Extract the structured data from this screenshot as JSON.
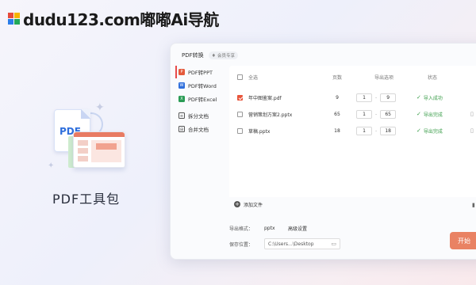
{
  "brand": {
    "text": "dudu123.com嘟嘟Ai导航"
  },
  "left": {
    "pdf_label": "PDF",
    "tool_title": "PDF工具包"
  },
  "window": {
    "title": "PDF转换",
    "vip_label": "会员专享"
  },
  "sidebar": {
    "items": [
      {
        "label": "PDF转PPT",
        "icon": "ppt-icon",
        "active": true
      },
      {
        "label": "PDF转Word",
        "icon": "word-icon"
      },
      {
        "label": "PDF转Excel",
        "icon": "excel-icon"
      },
      {
        "label": "拆分文档",
        "icon": "split-icon"
      },
      {
        "label": "合并文档",
        "icon": "merge-icon"
      }
    ]
  },
  "table": {
    "headers": {
      "select_all": "全选",
      "pages": "页数",
      "range": "导出选项",
      "status": "状态"
    },
    "rows": [
      {
        "name": "年中图鉴案.pdf",
        "pages": "9",
        "from": "1",
        "to": "9",
        "status": "导入成功",
        "checked": true
      },
      {
        "name": "营销策划方案2.pptx",
        "pages": "65",
        "from": "1",
        "to": "65",
        "status": "导出完成",
        "checked": false
      },
      {
        "name": "草稿.pptx",
        "pages": "18",
        "from": "1",
        "to": "18",
        "status": "导出完成",
        "checked": false
      }
    ]
  },
  "add_file_label": "添加文件",
  "options": {
    "format_label": "导出格式：",
    "format_value": "pptx",
    "advanced_label": "高级设置",
    "save_label": "保存位置：",
    "save_path": "C:\\Users...\\Desktop"
  },
  "start_label": "开始"
}
